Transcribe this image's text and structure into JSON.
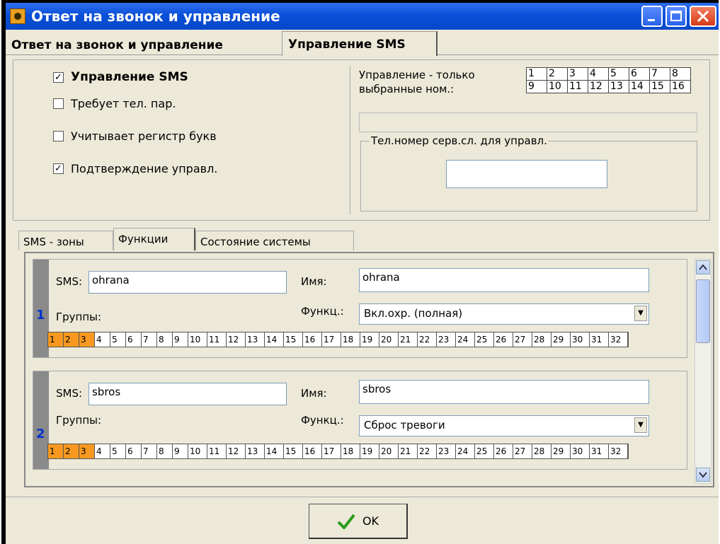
{
  "window": {
    "title": "Ответ на звонок и управление"
  },
  "tabs": [
    {
      "label": "Ответ на звонок и управление",
      "active": false
    },
    {
      "label": "Управление SMS",
      "active": true
    }
  ],
  "options": {
    "sms_control": {
      "label": "Управление SMS",
      "checked": true
    },
    "requires_password": {
      "label": "Требует тел. пар.",
      "checked": false
    },
    "case_sensitive": {
      "label": "Учитывает регистр букв",
      "checked": false
    },
    "confirmation": {
      "label": "Подтверждение управл.",
      "checked": true
    }
  },
  "selected_numbers": {
    "label_line1": "Управление - только",
    "label_line2": "выбранные ном.:",
    "row1": [
      "1",
      "2",
      "3",
      "4",
      "5",
      "6",
      "7",
      "8"
    ],
    "row2": [
      "9",
      "10",
      "11",
      "12",
      "13",
      "14",
      "15",
      "16"
    ]
  },
  "service_number": {
    "legend": "Тел.номер серв.сл. для управл.",
    "value": ""
  },
  "subtabs": [
    {
      "label": "SMS - зоны",
      "active": false
    },
    {
      "label": "Функции",
      "active": true
    },
    {
      "label": "Состояние системы",
      "active": false
    }
  ],
  "functions": [
    {
      "num": "1",
      "sms_label": "SMS:",
      "sms": "ohrana",
      "name_label": "Имя:",
      "name": "ohrana",
      "groups_label": "Группы:",
      "func_label": "Функц.:",
      "func": "Вкл.охр. (полная)",
      "active_groups": [
        "1",
        "2",
        "3"
      ]
    },
    {
      "num": "2",
      "sms_label": "SMS:",
      "sms": "sbros",
      "name_label": "Имя:",
      "name": "sbros",
      "groups_label": "Группы:",
      "func_label": "Функц.:",
      "func": "Сброс тревоги",
      "active_groups": [
        "1",
        "2",
        "3"
      ]
    }
  ],
  "groups_list": [
    "1",
    "2",
    "3",
    "4",
    "5",
    "6",
    "7",
    "8",
    "9",
    "10",
    "11",
    "12",
    "13",
    "14",
    "15",
    "16",
    "17",
    "18",
    "19",
    "20",
    "21",
    "22",
    "23",
    "24",
    "25",
    "26",
    "27",
    "28",
    "29",
    "30",
    "31",
    "32"
  ],
  "ok_button": {
    "label": "OK"
  },
  "colors": {
    "accent": "#f79920",
    "titlebar": "#0a4fd8",
    "number": "#0033cc"
  }
}
